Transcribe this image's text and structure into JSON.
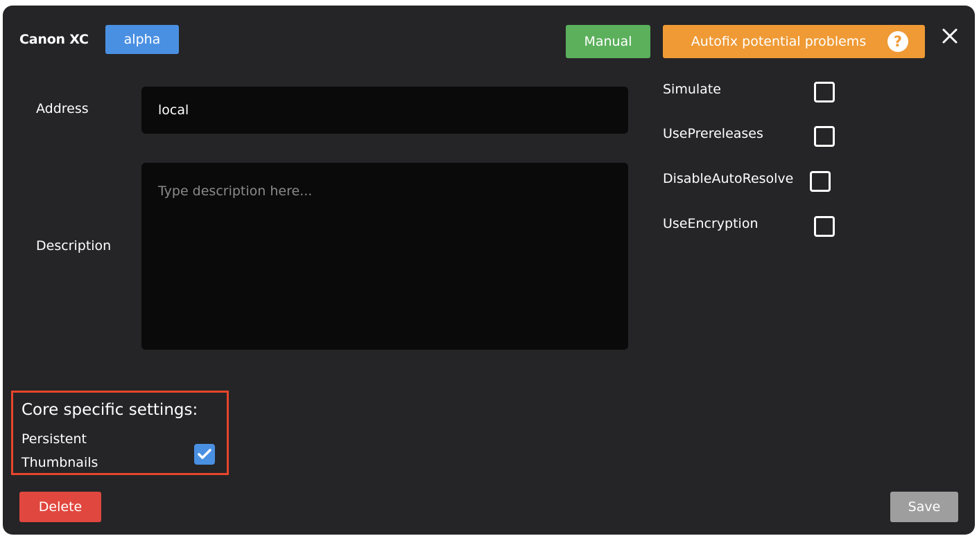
{
  "header": {
    "title": "Canon XC",
    "badge": "alpha",
    "manual_label": "Manual",
    "autofix_label": "Autofix potential problems",
    "help_glyph": "?"
  },
  "form": {
    "address_label": "Address",
    "address_value": "local",
    "description_label": "Description",
    "description_placeholder": "Type description here..."
  },
  "options": [
    {
      "label": "Simulate",
      "checked": false
    },
    {
      "label": "UsePrereleases",
      "checked": false
    },
    {
      "label": "DisableAutoResolve",
      "checked": false
    },
    {
      "label": "UseEncryption",
      "checked": false
    }
  ],
  "core": {
    "title": "Core specific settings:",
    "persistent_label": "Persistent Thumbnails",
    "persistent_checked": true
  },
  "footer": {
    "delete_label": "Delete",
    "save_label": "Save"
  },
  "colors": {
    "background": "#252527",
    "badge": "#4a90e2",
    "manual": "#5cb05c",
    "autofix": "#ef9a35",
    "delete": "#e0473e",
    "save": "#9e9e9e",
    "highlight": "#e8452c"
  },
  "icons": {
    "close": "close-icon",
    "help": "help-icon",
    "check": "checkmark-icon"
  }
}
